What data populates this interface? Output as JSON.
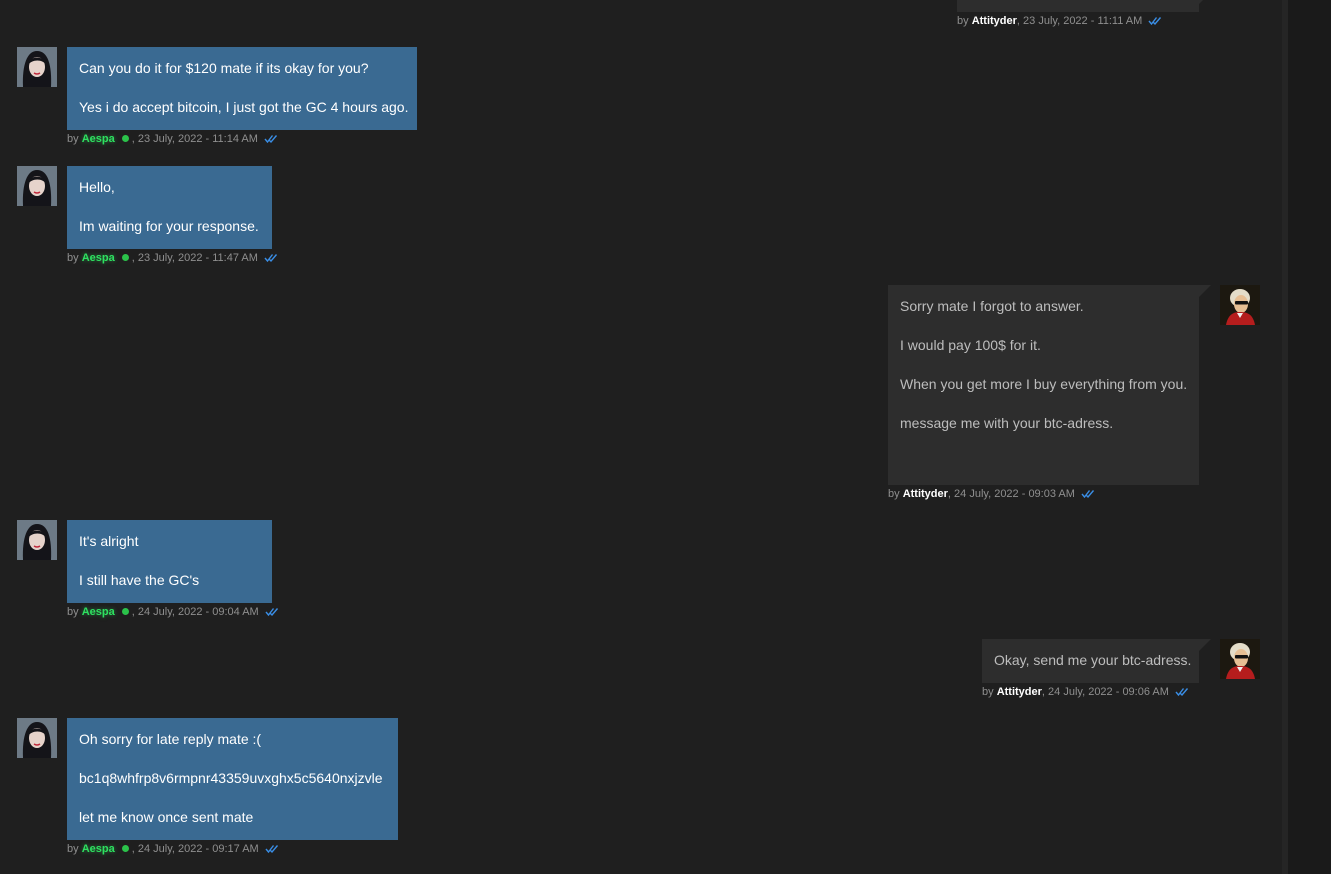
{
  "messages": [
    {
      "author": "Attityder",
      "sep": ", ",
      "date": "23 July, 2022 - 11:11 AM"
    },
    {
      "author": "Aespa",
      "sep": ", ",
      "date": "23 July, 2022 - 11:14 AM",
      "lines": [
        "Can you do it for $120 mate if its okay for you?",
        "Yes i do accept bitcoin, I just got the GC 4 hours ago."
      ]
    },
    {
      "author": "Aespa",
      "sep": ", ",
      "date": "23 July, 2022 - 11:47 AM",
      "lines": [
        "Hello,",
        "Im waiting for your response."
      ]
    },
    {
      "author": "Attityder",
      "sep": ", ",
      "date": "24 July, 2022 - 09:03 AM",
      "lines": [
        "Sorry mate I forgot to answer.",
        "I would pay 100$ for it.",
        "When you get more I buy everything from you.",
        "message me with your btc-adress."
      ]
    },
    {
      "author": "Aespa",
      "sep": ", ",
      "date": "24 July, 2022 - 09:04 AM",
      "lines": [
        "It's alright",
        "I still have the GC's"
      ]
    },
    {
      "author": "Attityder",
      "sep": ", ",
      "date": "24 July, 2022 - 09:06 AM",
      "lines": [
        "Okay, send me your btc-adress."
      ]
    },
    {
      "author": "Aespa",
      "sep": ", ",
      "date": "24 July, 2022 - 09:17 AM",
      "lines": [
        "Oh sorry for late reply mate :(",
        "bc1q8whfrp8v6rmpnr43359uvxghx5c5640nxjzvle",
        "let me know once sent mate"
      ]
    }
  ],
  "meta_prefix": "by ",
  "icons": {
    "read_receipt": "double-check-icon",
    "online": "online-status-dot"
  },
  "colors": {
    "incoming_bubble": "#3a6a92",
    "outgoing_bubble": "#2d2d2d",
    "online_name": "#2ee060",
    "check": "#3a8ee6"
  }
}
